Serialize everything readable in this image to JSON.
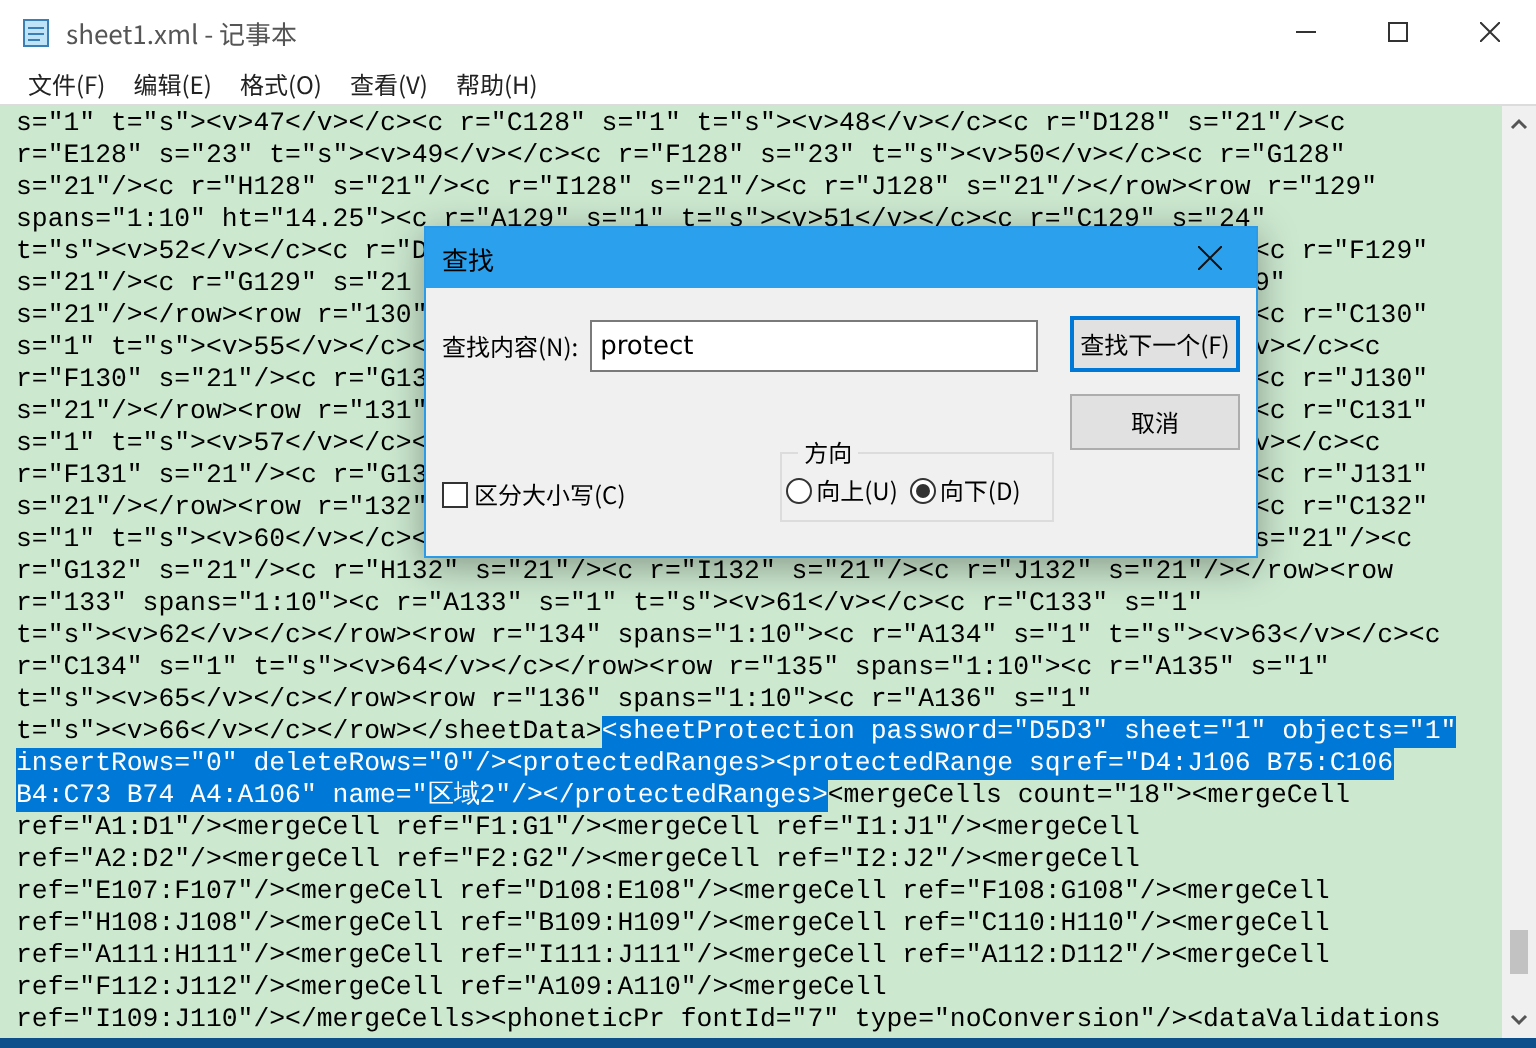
{
  "window": {
    "title": "sheet1.xml - 记事本"
  },
  "menu": [
    "文件(F)",
    "编辑(E)",
    "格式(O)",
    "查看(V)",
    "帮助(H)"
  ],
  "editor": {
    "lines": [
      {
        "segments": [
          {
            "text": "s=\"1\" t=\"s\"><v>47</v></c><c r=\"C128\" s=\"1\" t=\"s\"><v>48</v></c><c r=\"D128\" s=\"21\"/><c",
            "selected": false
          }
        ]
      },
      {
        "segments": [
          {
            "text": "r=\"E128\" s=\"23\" t=\"s\"><v>49</v></c><c r=\"F128\" s=\"23\" t=\"s\"><v>50</v></c><c r=\"G128\"",
            "selected": false
          }
        ]
      },
      {
        "segments": [
          {
            "text": "s=\"21\"/><c r=\"H128\" s=\"21\"/><c r=\"I128\" s=\"21\"/><c r=\"J128\" s=\"21\"/></row><row r=\"129\"",
            "selected": false
          }
        ]
      },
      {
        "segments": [
          {
            "text": "spans=\"1:10\" ht=\"14.25\"><c r=\"A129\" s=\"1\" t=\"s\"><v>51</v></c><c r=\"C129\" s=\"24\"",
            "selected": false
          }
        ]
      },
      {
        "segments": [
          {
            "text": "t=\"s\"><v>52</v></c><c r=\"D",
            "selected": false
          }
        ],
        "right": "<c r=\"F129\""
      },
      {
        "segments": [
          {
            "text": "s=\"21\"/><c r=\"G129\" s=\"21",
            "selected": false
          }
        ],
        "right": "9\""
      },
      {
        "segments": [
          {
            "text": "s=\"21\"/></row><row r=\"130\"",
            "selected": false
          }
        ],
        "right": "<c r=\"C130\""
      },
      {
        "segments": [
          {
            "text": "s=\"1\" t=\"s\"><v>55</v></c><",
            "selected": false
          }
        ],
        "right": "v></c><c"
      },
      {
        "segments": [
          {
            "text": "r=\"F130\" s=\"21\"/><c r=\"G13",
            "selected": false
          }
        ],
        "right": "<c r=\"J130\""
      },
      {
        "segments": [
          {
            "text": "s=\"21\"/></row><row r=\"131\"",
            "selected": false
          }
        ],
        "right": "<c r=\"C131\""
      },
      {
        "segments": [
          {
            "text": "s=\"1\" t=\"s\"><v>57</v></c><",
            "selected": false
          }
        ],
        "right": "v></c><c"
      },
      {
        "segments": [
          {
            "text": "r=\"F131\" s=\"21\"/><c r=\"G13",
            "selected": false
          }
        ],
        "right": "<c r=\"J131\""
      },
      {
        "segments": [
          {
            "text": "s=\"21\"/></row><row r=\"132\"",
            "selected": false
          }
        ],
        "right": "<c r=\"C132\""
      },
      {
        "segments": [
          {
            "text": "s=\"1\" t=\"s\"><v>60</v></c><",
            "selected": false
          }
        ],
        "right": "s=\"21\"/><c"
      },
      {
        "segments": [
          {
            "text": "r=\"G132\" s=\"21\"/><c r=\"H132\" s=\"21\"/><c r=\"I132\" s=\"21\"/><c r=\"J132\" s=\"21\"/></row><row",
            "selected": false
          }
        ]
      },
      {
        "segments": [
          {
            "text": "r=\"133\" spans=\"1:10\"><c r=\"A133\" s=\"1\" t=\"s\"><v>61</v></c><c r=\"C133\" s=\"1\"",
            "selected": false
          }
        ]
      },
      {
        "segments": [
          {
            "text": "t=\"s\"><v>62</v></c></row><row r=\"134\" spans=\"1:10\"><c r=\"A134\" s=\"1\" t=\"s\"><v>63</v></c><c",
            "selected": false
          }
        ]
      },
      {
        "segments": [
          {
            "text": "r=\"C134\" s=\"1\" t=\"s\"><v>64</v></c></row><row r=\"135\" spans=\"1:10\"><c r=\"A135\" s=\"1\"",
            "selected": false
          }
        ]
      },
      {
        "segments": [
          {
            "text": "t=\"s\"><v>65</v></c></row><row r=\"136\" spans=\"1:10\"><c r=\"A136\" s=\"1\"",
            "selected": false
          }
        ]
      },
      {
        "segments": [
          {
            "text": "t=\"s\"><v>66</v></c></row></sheetData>",
            "selected": false
          },
          {
            "text": "<sheetProtection password=\"D5D3\" sheet=\"1\" objects=\"1\"",
            "selected": true
          }
        ]
      },
      {
        "segments": [
          {
            "text": "insertRows=\"0\" deleteRows=\"0\"/><protectedRanges><protectedRange sqref=\"D4:J106 B75:C106",
            "selected": true
          }
        ]
      },
      {
        "segments": [
          {
            "text": "B4:C73 B74 A4:A106\" name=\"区域2\"/></protectedRanges>",
            "selected": true
          },
          {
            "text": "<mergeCells count=\"18\"><mergeCell",
            "selected": false
          }
        ]
      },
      {
        "segments": [
          {
            "text": "ref=\"A1:D1\"/><mergeCell ref=\"F1:G1\"/><mergeCell ref=\"I1:J1\"/><mergeCell",
            "selected": false
          }
        ]
      },
      {
        "segments": [
          {
            "text": "ref=\"A2:D2\"/><mergeCell ref=\"F2:G2\"/><mergeCell ref=\"I2:J2\"/><mergeCell",
            "selected": false
          }
        ]
      },
      {
        "segments": [
          {
            "text": "ref=\"E107:F107\"/><mergeCell ref=\"D108:E108\"/><mergeCell ref=\"F108:G108\"/><mergeCell",
            "selected": false
          }
        ]
      },
      {
        "segments": [
          {
            "text": "ref=\"H108:J108\"/><mergeCell ref=\"B109:H109\"/><mergeCell ref=\"C110:H110\"/><mergeCell",
            "selected": false
          }
        ]
      },
      {
        "segments": [
          {
            "text": "ref=\"A111:H111\"/><mergeCell ref=\"I111:J111\"/><mergeCell ref=\"A112:D112\"/><mergeCell",
            "selected": false
          }
        ]
      },
      {
        "segments": [
          {
            "text": "ref=\"F112:J112\"/><mergeCell ref=\"A109:A110\"/><mergeCell",
            "selected": false
          }
        ]
      },
      {
        "segments": [
          {
            "text": "ref=\"I109:J110\"/></mergeCells><phoneticPr fontId=\"7\" type=\"noConversion\"/><dataValidations",
            "selected": false
          }
        ]
      }
    ]
  },
  "find_dialog": {
    "title": "查找",
    "label": "查找内容(N):",
    "value": "protect",
    "find_next_button": "查找下一个(F)",
    "cancel_button": "取消",
    "match_case": {
      "label": "区分大小写(C)",
      "checked": false
    },
    "direction": {
      "title": "方向",
      "options": [
        {
          "label": "向上(U)",
          "selected": false
        },
        {
          "label": "向下(D)",
          "selected": true
        }
      ]
    }
  }
}
